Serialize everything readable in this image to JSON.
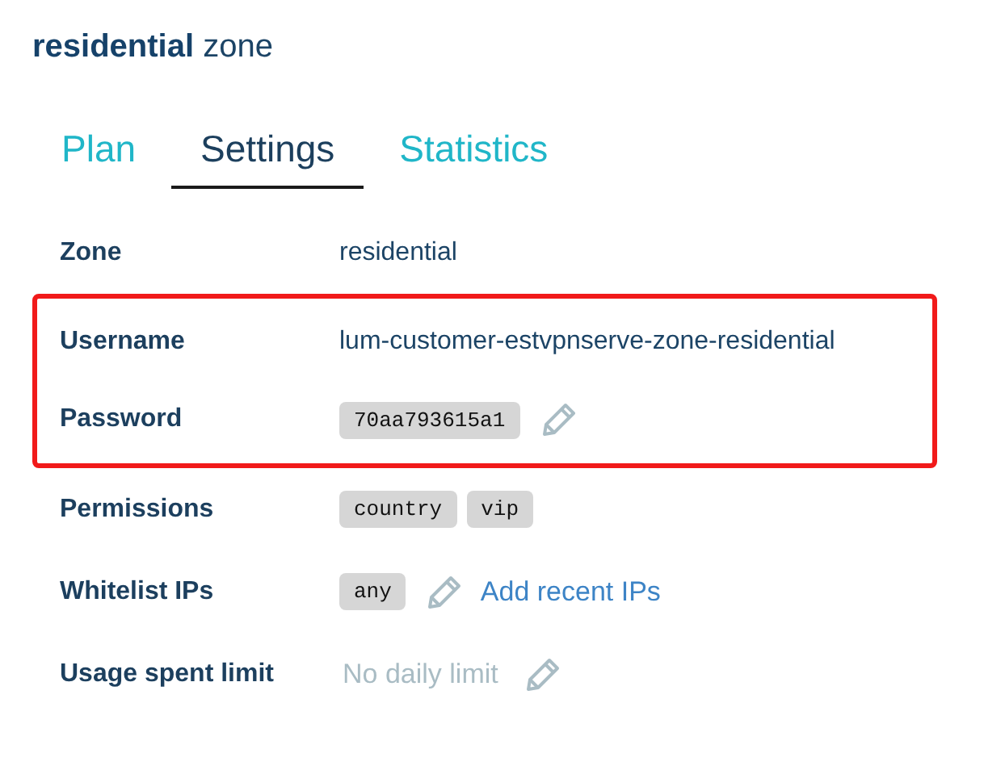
{
  "title": "**residential** zone",
  "tabs": [
    {
      "label": "Plan",
      "selected": false
    },
    {
      "label": "Settings",
      "selected": true
    },
    {
      "label": "Statistics",
      "selected": false
    }
  ],
  "rows": [
    {
      "label": "Zone",
      "highlighted": false,
      "items": [
        {
          "kind": "text",
          "text": "residential"
        }
      ]
    },
    {
      "label": "Username",
      "highlighted": true,
      "items": [
        {
          "kind": "text",
          "text": "lum-customer-estvpnserve-zone-residential"
        }
      ]
    },
    {
      "label": "Password",
      "highlighted": true,
      "items": [
        {
          "kind": "tag",
          "text": "70aa793615a1"
        },
        {
          "kind": "edit"
        }
      ]
    },
    {
      "label": "Permissions",
      "highlighted": false,
      "items": [
        {
          "kind": "tag",
          "text": "country"
        },
        {
          "kind": "tag",
          "text": "vip"
        }
      ]
    },
    {
      "label": "Whitelist IPs",
      "highlighted": false,
      "items": [
        {
          "kind": "tag",
          "text": "any"
        },
        {
          "kind": "edit"
        },
        {
          "kind": "link",
          "text": "Add recent IPs"
        }
      ]
    },
    {
      "label": "Usage spent limit",
      "highlighted": false,
      "items": [
        {
          "kind": "muted",
          "text": "No daily limit"
        },
        {
          "kind": "edit"
        }
      ]
    }
  ]
}
